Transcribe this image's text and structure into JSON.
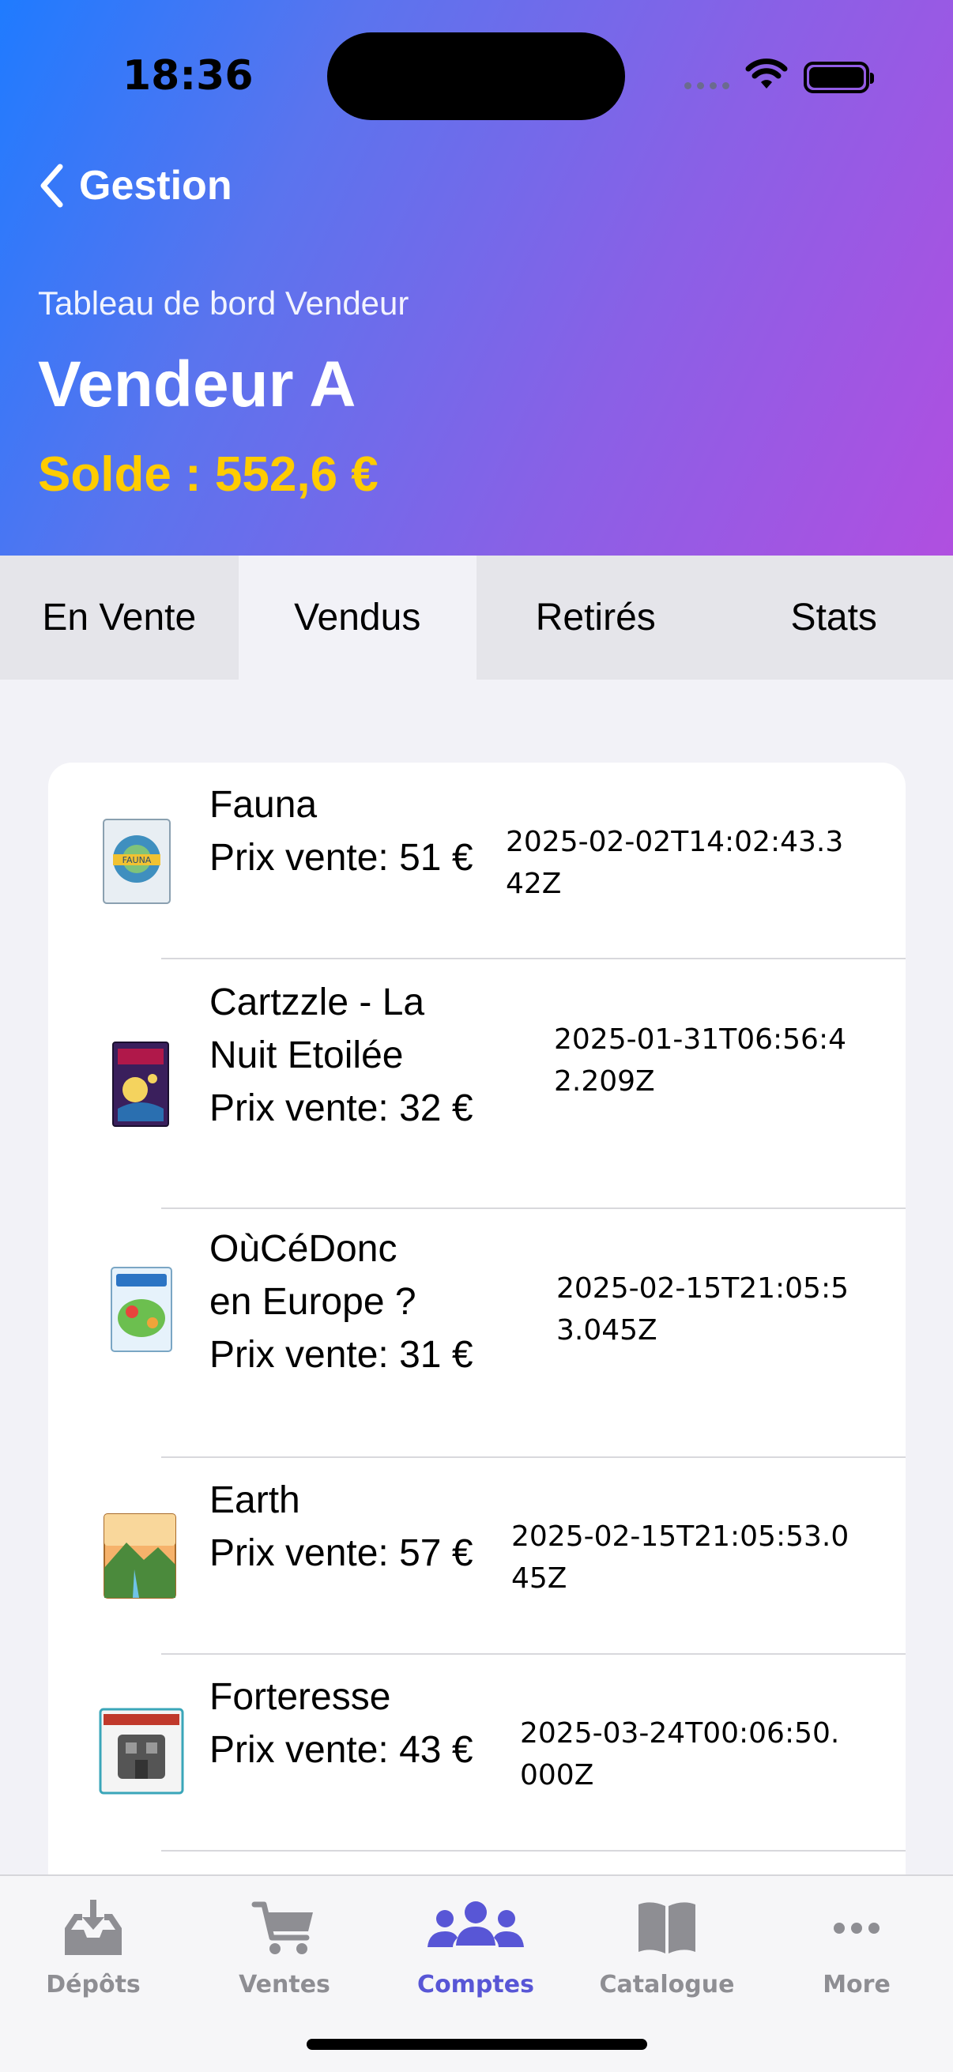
{
  "status_bar": {
    "time": "18:36"
  },
  "nav": {
    "back_label": "Gestion"
  },
  "header": {
    "subtitle": "Tableau de bord Vendeur",
    "vendor_name": "Vendeur A",
    "balance": "Solde : 552,6 €",
    "balance_color": "#ffcc00"
  },
  "tabs": [
    {
      "label": "En Vente",
      "active": false
    },
    {
      "label": "Vendus",
      "active": true
    },
    {
      "label": "Retirés",
      "active": false
    },
    {
      "label": "Stats",
      "active": false
    }
  ],
  "sold_items": [
    {
      "name_lines": [
        "Fauna"
      ],
      "price": "Prix vente: 51 €",
      "date_lines": [
        "2025-02-02T14:02:43.3",
        "42Z"
      ],
      "thumb_icon": "fauna-box-icon"
    },
    {
      "name_lines": [
        "Cartzzle - La",
        "Nuit Etoilée"
      ],
      "price": "Prix vente: 32 €",
      "date_lines": [
        "2025-01-31T06:56:4",
        "2.209Z"
      ],
      "thumb_icon": "cartzzle-box-icon"
    },
    {
      "name_lines": [
        "OùCéDonc",
        "en Europe ?"
      ],
      "price": "Prix vente: 31 €",
      "date_lines": [
        "2025-02-15T21:05:5",
        "3.045Z"
      ],
      "thumb_icon": "oucedonc-box-icon"
    },
    {
      "name_lines": [
        "Earth"
      ],
      "price": "Prix vente: 57 €",
      "date_lines": [
        "2025-02-15T21:05:53.0",
        "45Z"
      ],
      "thumb_icon": "earth-box-icon"
    },
    {
      "name_lines": [
        "Forteresse"
      ],
      "price": "Prix vente: 43 €",
      "date_lines": [
        "2025-03-24T00:06:50.",
        "000Z"
      ],
      "thumb_icon": "forteresse-box-icon"
    }
  ],
  "tab_bar": [
    {
      "label": "Dépôts",
      "icon": "inbox-download-icon",
      "active": false
    },
    {
      "label": "Ventes",
      "icon": "cart-icon",
      "active": false
    },
    {
      "label": "Comptes",
      "icon": "people-icon",
      "active": true
    },
    {
      "label": "Catalogue",
      "icon": "book-icon",
      "active": false
    },
    {
      "label": "More",
      "icon": "more-icon",
      "active": false
    }
  ],
  "colors": {
    "accent": "#5856d6",
    "inactive": "#8e8e93"
  }
}
